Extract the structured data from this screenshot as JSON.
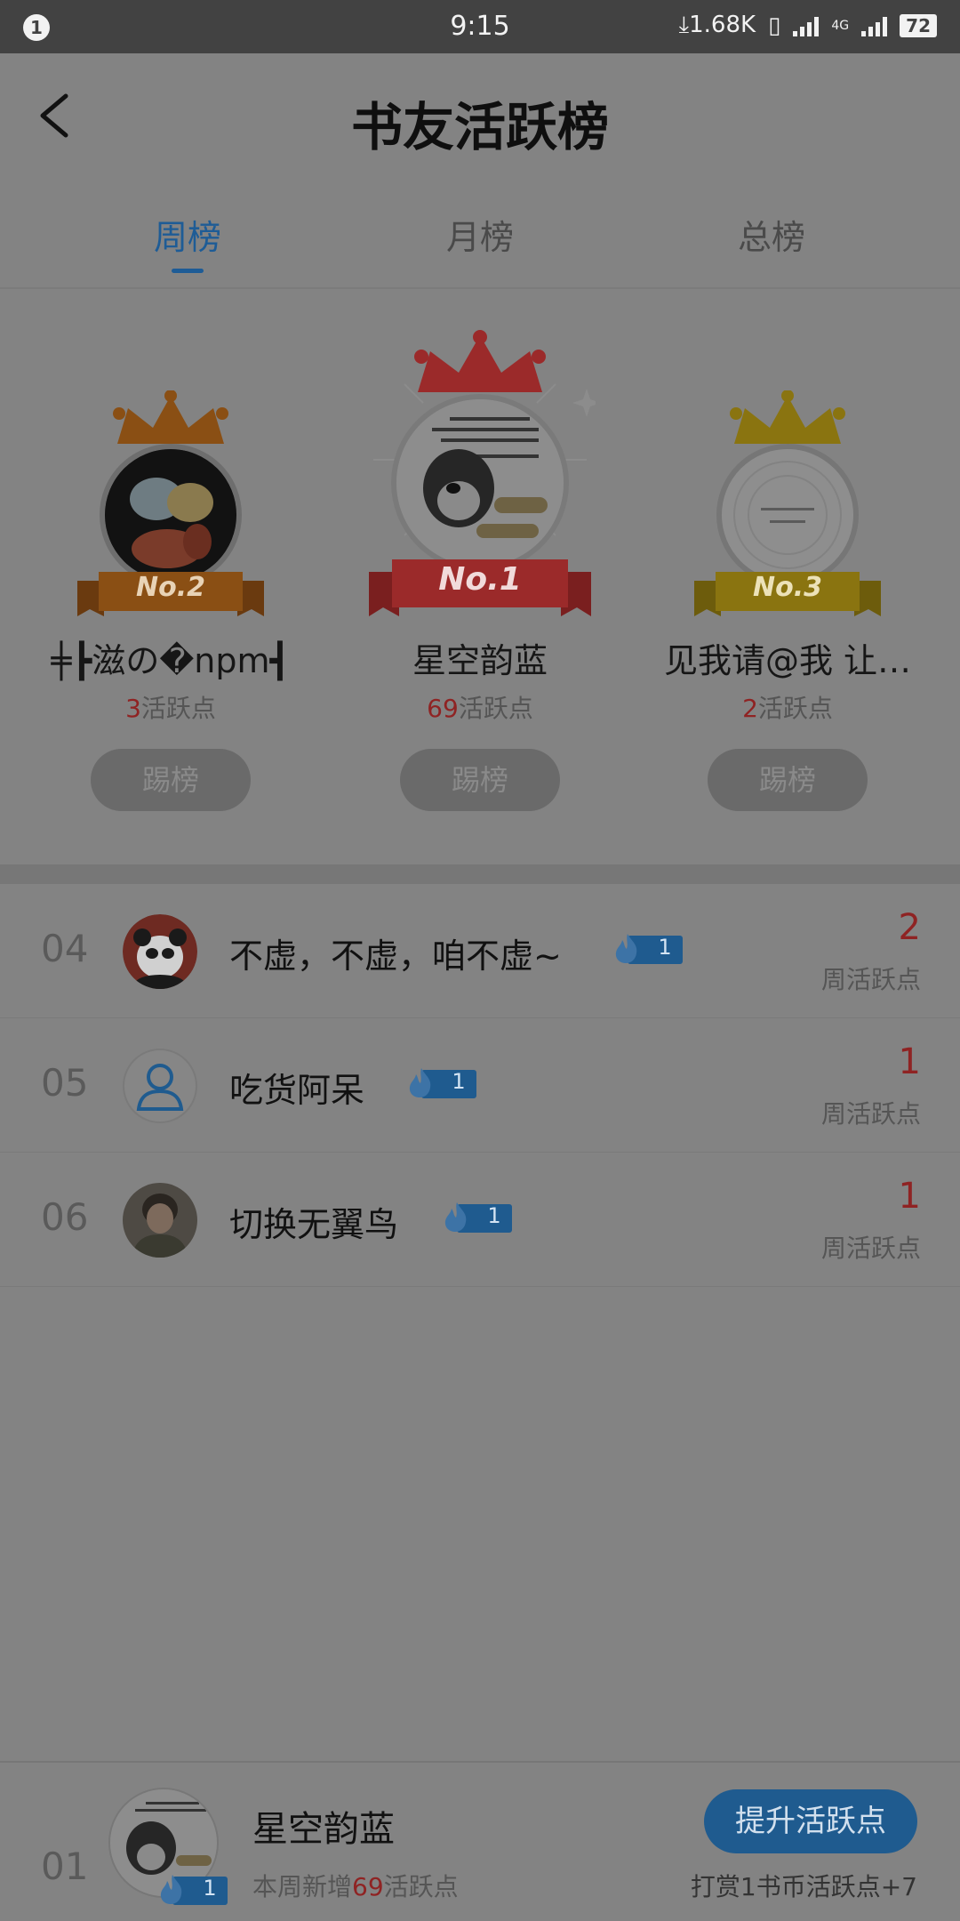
{
  "status_bar": {
    "notif_count": "1",
    "time": "9:15",
    "net_speed": "1.68K",
    "network_label": "4G",
    "battery": "72"
  },
  "header": {
    "title": "书友活跃榜"
  },
  "tabs": [
    {
      "label": "周榜",
      "active": true
    },
    {
      "label": "月榜",
      "active": false
    },
    {
      "label": "总榜",
      "active": false
    }
  ],
  "podium": {
    "first": {
      "rank_label": "No.1",
      "name": "星空韵蓝",
      "points": "69",
      "points_unit": "活跃点",
      "button": "踢榜",
      "crown_color": "#9b2a2a"
    },
    "second": {
      "rank_label": "No.2",
      "name": "╪┣滋の�npm┫",
      "points": "3",
      "points_unit": "活跃点",
      "button": "踢榜",
      "crown_color": "#8a4f14"
    },
    "third": {
      "rank_label": "No.3",
      "name": "见我请@我 让…",
      "points": "2",
      "points_unit": "活跃点",
      "button": "踢榜",
      "crown_color": "#8a7410"
    }
  },
  "list": [
    {
      "rank": "04",
      "name": "不虚，不虚，咱不虚~",
      "badge": "1",
      "score": "2",
      "score_label": "周活跃点"
    },
    {
      "rank": "05",
      "name": "吃货阿呆",
      "badge": "1",
      "score": "1",
      "score_label": "周活跃点"
    },
    {
      "rank": "06",
      "name": "切换无翼鸟",
      "badge": "1",
      "score": "1",
      "score_label": "周活跃点"
    }
  ],
  "my_entry": {
    "rank": "01",
    "name": "星空韵蓝",
    "badge": "1",
    "sub_prefix": "本周新增",
    "sub_points": "69",
    "sub_suffix": "活跃点",
    "boost_button": "提升活跃点",
    "reward_hint": "打赏1书币活跃点+7"
  },
  "colors": {
    "accent": "#1e5c96",
    "points_red": "#8f2323",
    "overlay_bg": "#838383"
  }
}
